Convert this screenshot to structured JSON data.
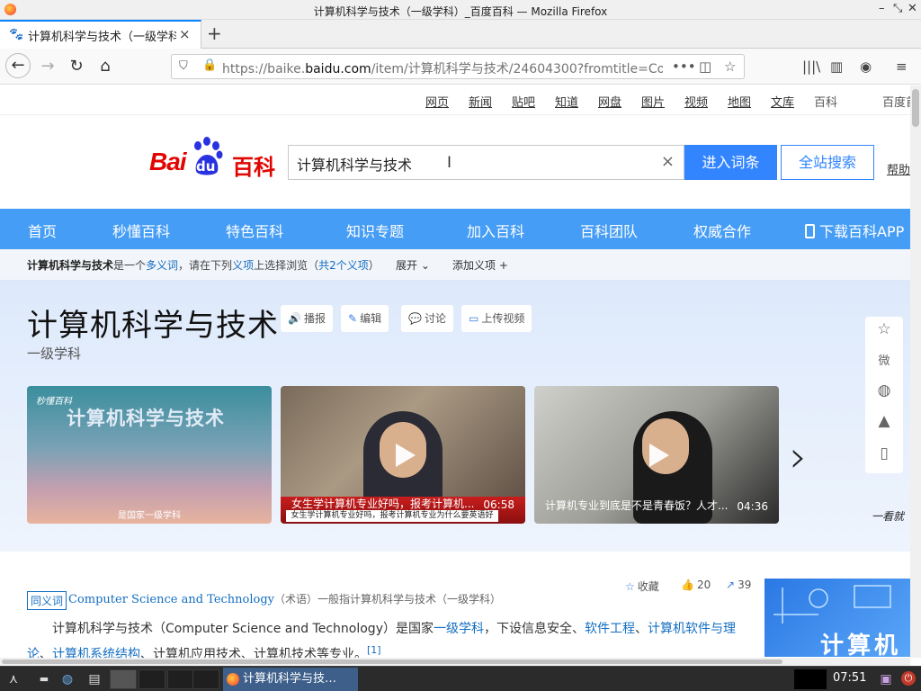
{
  "window": {
    "title": "计算机科学与技术（一级学科）_百度百科 — Mozilla Firefox",
    "minimize": "–",
    "restore": "⤡",
    "close": "✕"
  },
  "tabs": [
    {
      "title": "计算机科学与技术（一级学科",
      "close": "×",
      "favicon": "baidu-paw-icon"
    }
  ],
  "new_tab": "+",
  "nav": {
    "back": "←",
    "forward": "→",
    "reload": "↻",
    "home": "⌂",
    "url_prefix": "https://baike.",
    "url_domain": "baidu.com",
    "url_rest": "/item/计算机科学与技术/24604300?fromtitle=Co",
    "page_actions": "•••",
    "pocket": "◫",
    "bookmark_star": "☆",
    "library": "|||\\",
    "sidebar": "▥",
    "account": "◉",
    "menu": "≡"
  },
  "top_links": [
    "网页",
    "新闻",
    "贴吧",
    "知道",
    "网盘",
    "图片",
    "视频",
    "地图",
    "文库",
    "百科",
    "百度首页"
  ],
  "logo": {
    "bai": "Bai",
    "du": "du",
    "baike": "百科"
  },
  "search": {
    "value": "计算机科学与技术",
    "clear": "×",
    "cursor": "I",
    "enter_button": "进入词条",
    "all_button": "全站搜索",
    "help": "帮助"
  },
  "blue_nav": [
    "首页",
    "秒懂百科",
    "特色百科",
    "知识专题",
    "加入百科",
    "百科团队",
    "权威合作",
    "下载百科APP"
  ],
  "polysemy": {
    "term": "计算机科学与技术",
    "text1": "是一个",
    "link1": "多义词",
    "text2": "，请在下列",
    "link2": "义项",
    "text3": "上选择浏览（",
    "link3": "共2个义项",
    "text4": "）",
    "expand": "展开 ⌄",
    "add": "添加义项 +"
  },
  "entry": {
    "title": "计算机科学与技术",
    "subtitle": "一级学科",
    "buttons": [
      {
        "icon": "🔊",
        "label": "播报"
      },
      {
        "icon": "✎",
        "label": "编辑"
      },
      {
        "icon": "💬",
        "label": "讨论"
      },
      {
        "icon": "▭",
        "label": "上传视频"
      }
    ]
  },
  "videos": [
    {
      "brand": "秒懂百科",
      "overlay": "计算机科学与技术",
      "subtitle": "是国家一级学科"
    },
    {
      "caption": "女生学计算机专业好吗，报考计算机...",
      "duration": "06:58",
      "subtitle": "女生学计算机专业好吗，报考计算机专业为什么要英语好"
    },
    {
      "caption": "计算机专业到底是不是青春饭？人才...",
      "duration": "04:36"
    }
  ],
  "next_arrow": "›",
  "share_icons": [
    "☆",
    "微",
    "◍",
    "▲",
    "▯"
  ],
  "share_icon_names": [
    "favorite-star-icon",
    "weibo-icon",
    "wechat-icon",
    "qq-icon",
    "mobile-icon"
  ],
  "side_partial": "一看就",
  "article": {
    "collect": "收藏",
    "likes": "20",
    "shares": "39",
    "synonym_tag": "同义词",
    "synonym_en": "Computer Science and Technology",
    "synonym_rest": "（术语）一般指计算机科学与技术（一级学科）",
    "para_a": "计算机科学与技术（Computer Science and Technology）是国家",
    "link_a": "一级学科",
    "para_b": "，下设信息安全、",
    "link_b": "软件工程",
    "para_c": "、",
    "link_c": "计算机软件与理论",
    "para_d": "、",
    "link_d": "计算机系统结构",
    "para_e": "、计算机应用技术、计算机技术等专业。",
    "ref": "[1]",
    "ad_text": "计算机"
  },
  "taskbar": {
    "task_title": "计算机科学与技…",
    "clock": "07:51",
    "power": "⏻"
  }
}
